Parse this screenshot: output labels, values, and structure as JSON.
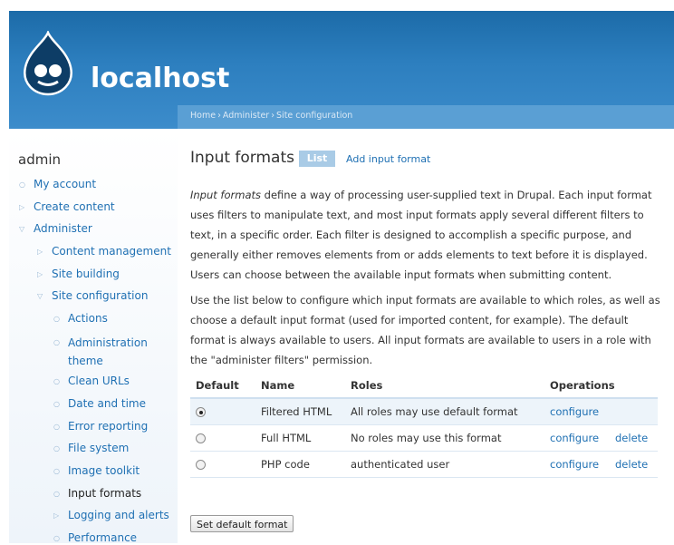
{
  "site": {
    "name": "localhost"
  },
  "breadcrumb": [
    "Home",
    "Administer",
    "Site configuration"
  ],
  "breadcrumb_separator": "›",
  "sidebar": {
    "title": "admin",
    "items": [
      {
        "label": "My account",
        "level": 0,
        "bullet": "○"
      },
      {
        "label": "Create content",
        "level": 0,
        "bullet": "▷"
      },
      {
        "label": "Administer",
        "level": 0,
        "bullet": "▽"
      },
      {
        "label": "Content management",
        "level": 1,
        "bullet": "▷"
      },
      {
        "label": "Site building",
        "level": 1,
        "bullet": "▷"
      },
      {
        "label": "Site configuration",
        "level": 1,
        "bullet": "▽"
      },
      {
        "label": "Actions",
        "level": 2,
        "bullet": "○"
      },
      {
        "label": "Administration theme",
        "level": 2,
        "bullet": "○"
      },
      {
        "label": "Clean URLs",
        "level": 2,
        "bullet": "○"
      },
      {
        "label": "Date and time",
        "level": 2,
        "bullet": "○"
      },
      {
        "label": "Error reporting",
        "level": 2,
        "bullet": "○"
      },
      {
        "label": "File system",
        "level": 2,
        "bullet": "○"
      },
      {
        "label": "Image toolkit",
        "level": 2,
        "bullet": "○"
      },
      {
        "label": "Input formats",
        "level": 2,
        "bullet": "○",
        "active": true
      },
      {
        "label": "Logging and alerts",
        "level": 2,
        "bullet": "▷"
      },
      {
        "label": "Performance",
        "level": 2,
        "bullet": "○"
      }
    ]
  },
  "main": {
    "title": "Input formats",
    "tabs": {
      "list": "List",
      "add": "Add input format"
    },
    "intro_em": "Input formats",
    "intro_rest": " define a way of processing user-supplied text in Drupal. Each input format uses filters to manipulate text, and most input formats apply several different filters to text, in a specific order. Each filter is designed to accomplish a specific purpose, and generally either removes elements from or adds elements to text before it is displayed. Users can choose between the available input formats when submitting content.",
    "paragraph2": "Use the list below to configure which input formats are available to which roles, as well as choose a default input format (used for imported content, for example). The default format is always available to users. All input formats are available to users in a role with the \"administer filters\" permission.",
    "table": {
      "headers": [
        "Default",
        "Name",
        "Roles",
        "Operations"
      ],
      "rows": [
        {
          "default": true,
          "name": "Filtered HTML",
          "roles": "All roles may use default format",
          "configure": "configure",
          "delete": ""
        },
        {
          "default": false,
          "name": "Full HTML",
          "roles": "No roles may use this format",
          "configure": "configure",
          "delete": "delete"
        },
        {
          "default": false,
          "name": "PHP code",
          "roles": "authenticated user",
          "configure": "configure",
          "delete": "delete"
        }
      ]
    },
    "submit_label": "Set default format"
  }
}
